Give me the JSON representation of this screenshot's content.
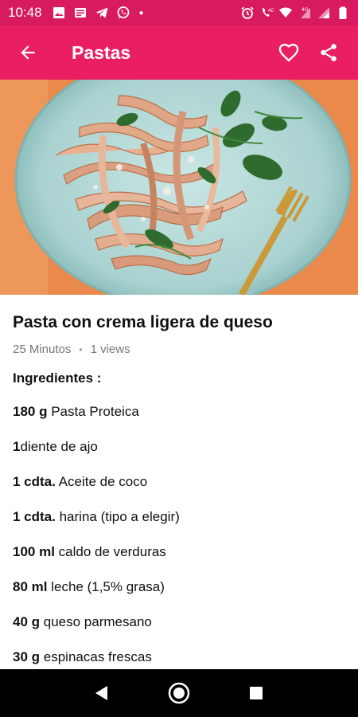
{
  "status_bar": {
    "time": "10:48",
    "left_icons": [
      "image-icon",
      "news-icon",
      "telegram-icon",
      "whatsapp-icon"
    ],
    "right_icons": [
      "alarm-icon",
      "volte-icon",
      "wifi-icon",
      "signal-4g-icon",
      "signal-icon",
      "battery-icon"
    ],
    "network_label": "4G"
  },
  "app_bar": {
    "title": "Pastas",
    "background": "#e91e63",
    "actions": [
      "favorite-icon",
      "share-icon"
    ]
  },
  "recipe": {
    "title": "Pasta con crema ligera de queso",
    "duration": "25 Minutos",
    "views": "1 views",
    "ingredients_header": "Ingredientes :",
    "ingredients": [
      {
        "qty": "180 g",
        "name": "Pasta Proteica"
      },
      {
        "qty": "1",
        "name": "diente de ajo"
      },
      {
        "qty": "1 cdta.",
        "name": "Aceite de coco"
      },
      {
        "qty": "1 cdta.",
        "name": "harina (tipo a elegir)"
      },
      {
        "qty": "100 ml",
        "name": "caldo de verduras"
      },
      {
        "qty": "80 ml",
        "name": "leche (1,5% grasa)"
      },
      {
        "qty": "40 g",
        "name": "queso parmesano"
      },
      {
        "qty": "30 g",
        "name": "espinacas frescas"
      }
    ]
  },
  "nav_bar": {
    "buttons": [
      "back-triangle-icon",
      "home-circle-icon",
      "recents-square-icon"
    ]
  }
}
